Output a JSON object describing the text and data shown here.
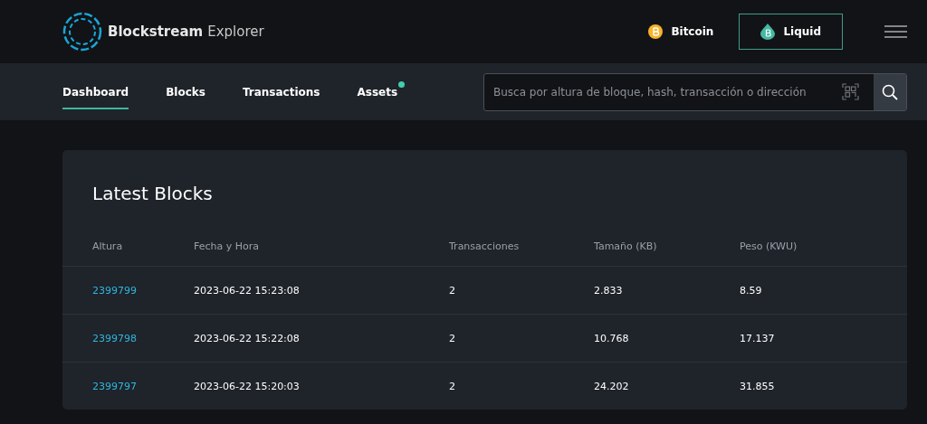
{
  "brand": {
    "name": "Blockstream",
    "product": "Explorer"
  },
  "networks": [
    {
      "label": "Bitcoin",
      "kind": "bitcoin",
      "selected": false
    },
    {
      "label": "Liquid",
      "kind": "liquid",
      "selected": true
    }
  ],
  "tabs": [
    {
      "label": "Dashboard",
      "selected": true,
      "dot": false
    },
    {
      "label": "Blocks",
      "selected": false,
      "dot": false
    },
    {
      "label": "Transactions",
      "selected": false,
      "dot": false
    },
    {
      "label": "Assets",
      "selected": false,
      "dot": true
    }
  ],
  "search": {
    "placeholder": "Busca por altura de bloque, hash, transacción o dirección"
  },
  "latest_blocks": {
    "title": "Latest Blocks",
    "columns": [
      "Altura",
      "Fecha y Hora",
      "Transacciones",
      "Tamaño (KB)",
      "Peso (KWU)"
    ],
    "rows": [
      [
        "2399799",
        "2023-06-22 15:23:08",
        "2",
        "2.833",
        "8.59"
      ],
      [
        "2399798",
        "2023-06-22 15:22:08",
        "2",
        "10.768",
        "17.137"
      ],
      [
        "2399797",
        "2023-06-22 15:20:03",
        "2",
        "24.202",
        "31.855"
      ]
    ]
  }
}
